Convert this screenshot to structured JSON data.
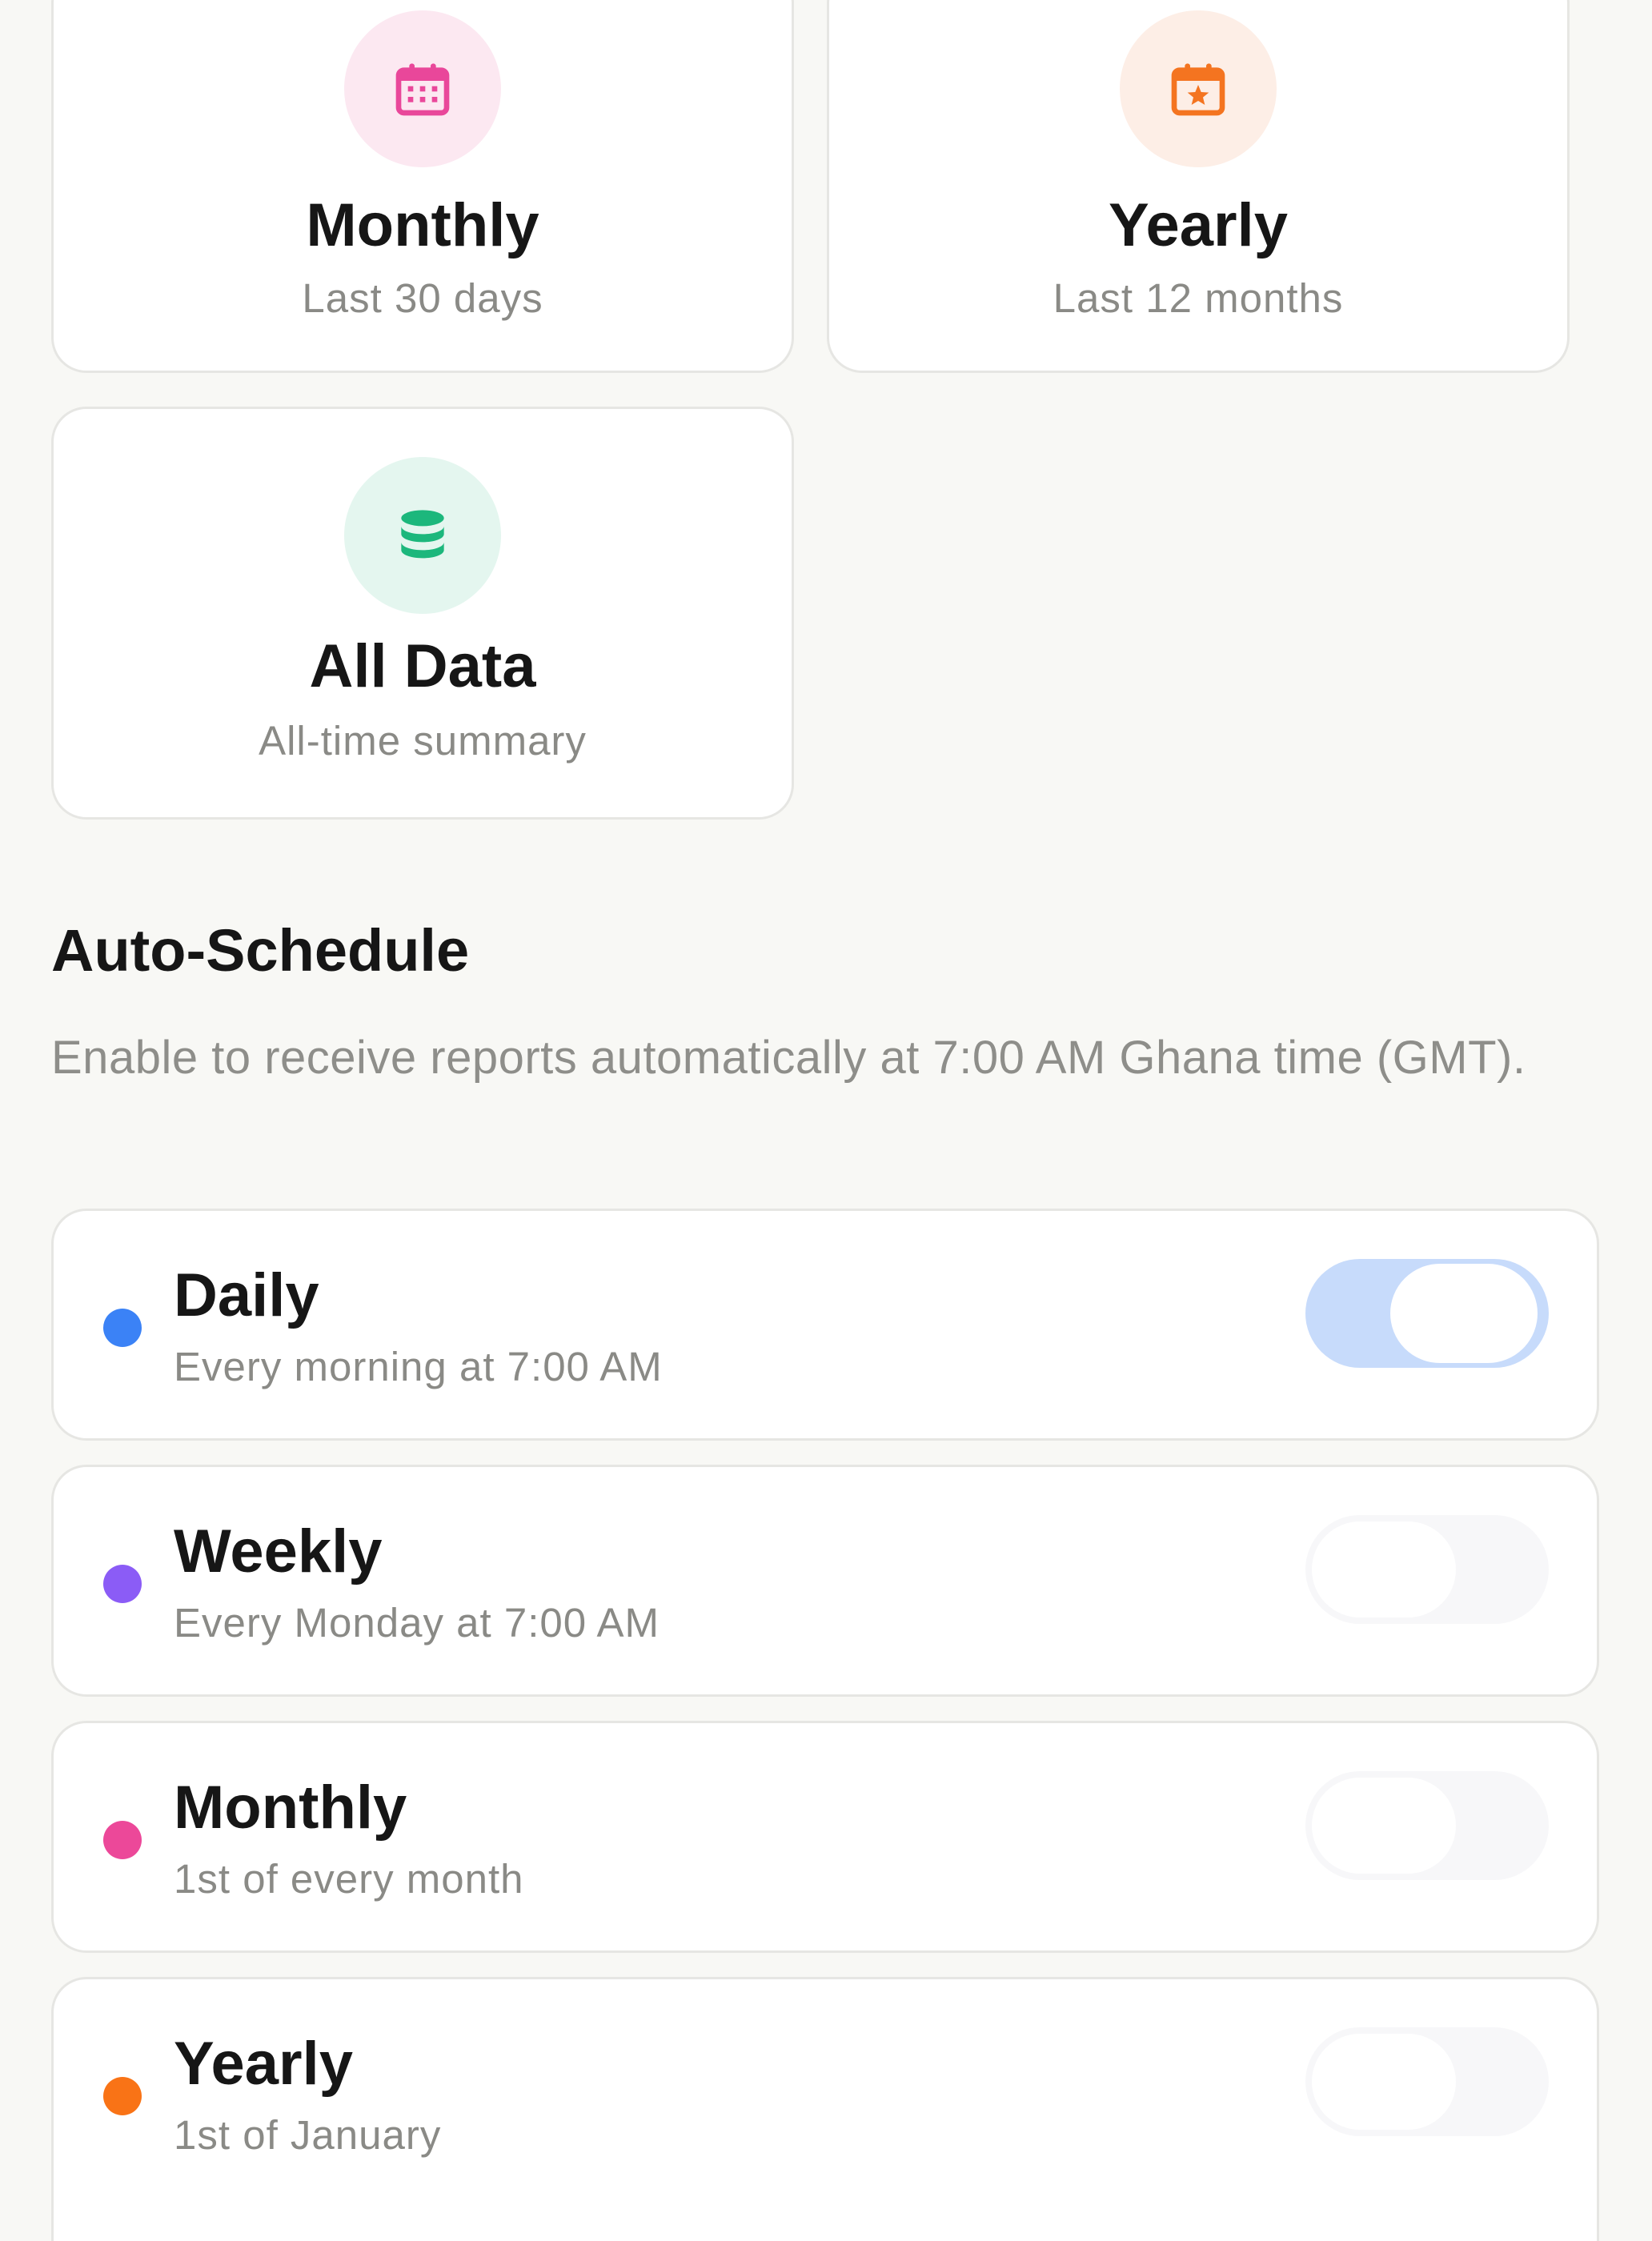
{
  "report_types": [
    {
      "title": "Monthly",
      "subtitle": "Last 30 days",
      "icon": "calendar-grid-icon",
      "icon_color": "#e9479a",
      "bg": "#fce8f1"
    },
    {
      "title": "Yearly",
      "subtitle": "Last 12 months",
      "icon": "calendar-star-icon",
      "icon_color": "#f47420",
      "bg": "#fdeee6"
    },
    {
      "title": "All Data",
      "subtitle": "All-time summary",
      "icon": "database-icon",
      "icon_color": "#1cb77c",
      "bg": "#e4f6ef"
    }
  ],
  "auto_schedule": {
    "title": "Auto-Schedule",
    "description": "Enable to receive reports automatically at 7:00 AM Ghana time (GMT).",
    "items": [
      {
        "title": "Daily",
        "subtitle": "Every morning at 7:00 AM",
        "dot_color": "#3b82f6",
        "enabled": true
      },
      {
        "title": "Weekly",
        "subtitle": "Every Monday at 7:00 AM",
        "dot_color": "#8b5cf6",
        "enabled": false
      },
      {
        "title": "Monthly",
        "subtitle": "1st of every month",
        "dot_color": "#ec4899",
        "enabled": false
      },
      {
        "title": "Yearly",
        "subtitle": "1st of January",
        "dot_color": "#f97316",
        "enabled": false
      }
    ]
  }
}
